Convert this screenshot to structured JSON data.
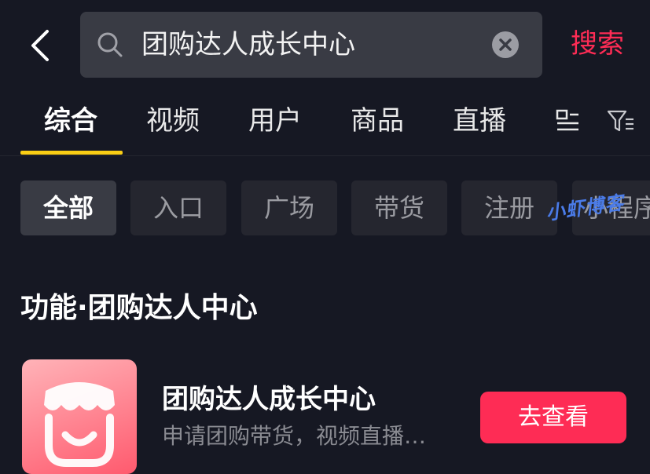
{
  "search": {
    "query": "团购达人成长中心",
    "submit_label": "搜索"
  },
  "tabs": [
    {
      "label": "综合",
      "active": true
    },
    {
      "label": "视频"
    },
    {
      "label": "用户"
    },
    {
      "label": "商品"
    },
    {
      "label": "直播"
    }
  ],
  "tab_icons": [
    "layout-icon",
    "filter-icon"
  ],
  "chips": [
    {
      "label": "全部",
      "active": true
    },
    {
      "label": "入口"
    },
    {
      "label": "广场"
    },
    {
      "label": "带货"
    },
    {
      "label": "注册"
    },
    {
      "label": "小程序"
    }
  ],
  "watermark": "小虾博客",
  "section": {
    "title": "功能·团购达人中心"
  },
  "result": {
    "title": "团购达人成长中心",
    "description": "申请团购带货，视频直播…",
    "button_label": "去查看"
  },
  "colors": {
    "accent": "#fe2c55",
    "tab_indicator": "#face15",
    "background": "#161823"
  }
}
